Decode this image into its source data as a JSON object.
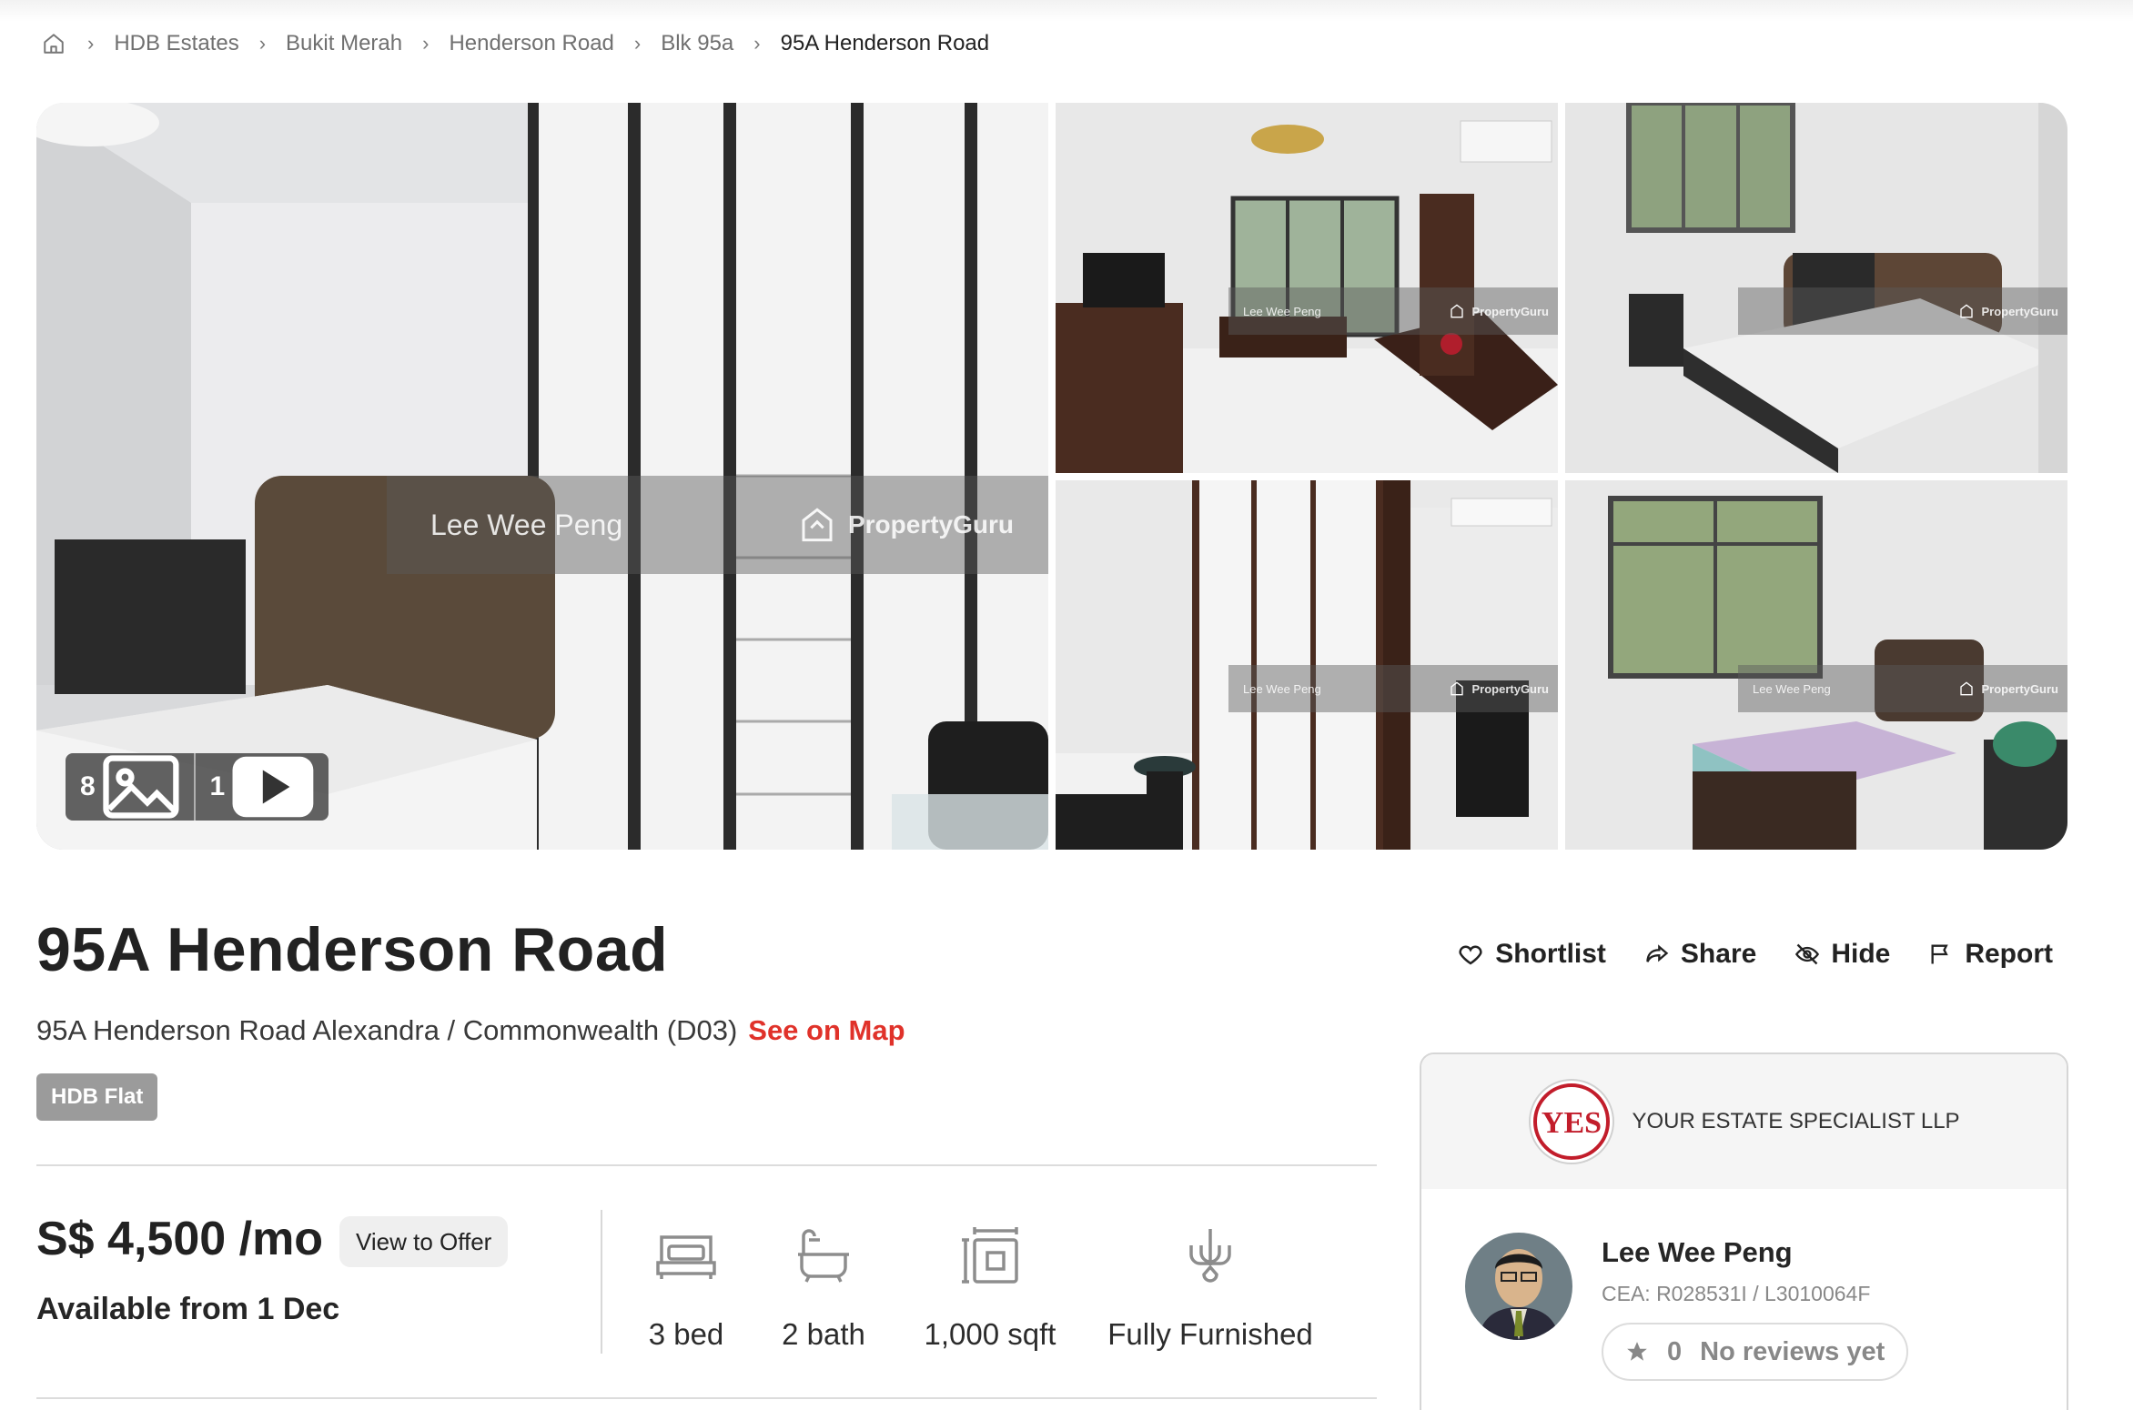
{
  "breadcrumb": {
    "items": [
      "HDB Estates",
      "Bukit Merah",
      "Henderson Road",
      "Blk 95a"
    ],
    "current": "95A Henderson Road"
  },
  "gallery": {
    "watermark_agent": "Lee Wee Peng",
    "watermark_brand": "PropertyGuru",
    "photo_count": "8",
    "video_count": "1"
  },
  "listing": {
    "title": "95A Henderson Road",
    "address": "95A Henderson Road Alexandra / Commonwealth (D03)",
    "map_link": "See on Map",
    "property_type": "HDB Flat",
    "price": "S$ 4,500 /mo",
    "offer_button": "View to Offer",
    "availability": "Available from 1 Dec"
  },
  "actions": {
    "shortlist": "Shortlist",
    "share": "Share",
    "hide": "Hide",
    "report": "Report"
  },
  "features": {
    "bed": "3 bed",
    "bath": "2 bath",
    "area": "1,000 sqft",
    "furnishing": "Fully Furnished"
  },
  "agent": {
    "agency": "YOUR ESTATE SPECIALIST LLP",
    "logo_text": "YES",
    "name": "Lee Wee Peng",
    "cea": "CEA: R028531I / L3010064F",
    "review_count": "0",
    "review_text": "No reviews yet"
  },
  "colors": {
    "accent_red": "#e0322a",
    "badge_gray": "#9b9b9b"
  }
}
